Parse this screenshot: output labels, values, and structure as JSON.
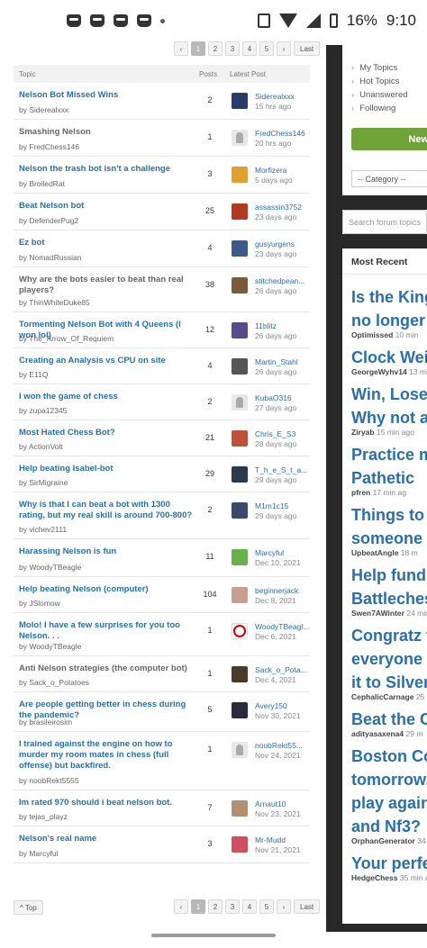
{
  "status": {
    "battery": "16%",
    "time": "9:10",
    "icons": [
      "discord-icon",
      "discord-icon",
      "discord-icon",
      "discord-icon",
      "dot-icon"
    ]
  },
  "pagination": {
    "pages": [
      "1",
      "2",
      "3",
      "4",
      "5"
    ],
    "last": "Last",
    "prev": "‹",
    "next": "›"
  },
  "table": {
    "col_topic": "Topic",
    "col_posts": "Posts",
    "col_latest": "Latest Post"
  },
  "topics": [
    {
      "title": "Nelson Bot Missed Wins",
      "author": "by Siderealxxx",
      "posts": "2",
      "user": "Siderealxxx",
      "time": "15 hrs ago",
      "read": false,
      "avatar": "#2a3b6b"
    },
    {
      "title": "Smashing Nelson",
      "author": "by FredChess146",
      "posts": "1",
      "user": "FredChess146",
      "time": "20 hrs ago",
      "read": true,
      "avatar": "#bdbdbd"
    },
    {
      "title": "Nelson the trash bot isn't a challenge",
      "author": "by BroiledRat",
      "posts": "3",
      "user": "Morfizera",
      "time": "5 days ago",
      "read": false,
      "avatar": "#e0a030"
    },
    {
      "title": "Beat Nelson bot",
      "author": "by DefenderPug2",
      "posts": "25",
      "user": "assassin3752",
      "time": "23 days ago",
      "read": false,
      "avatar": "#b33a1f"
    },
    {
      "title": "Ez bot",
      "author": "by NomadRussian",
      "posts": "4",
      "user": "gusyurgens",
      "time": "23 days ago",
      "read": false,
      "avatar": "#3a5a8a"
    },
    {
      "title": "Why are the bots easier to beat than real players?",
      "author": "by ThinWhiteDuke85",
      "posts": "38",
      "user": "stitchedpean...",
      "time": "26 days ago",
      "read": true,
      "avatar": "#7a5a3a"
    },
    {
      "title": "Tormenting Nelson Bot with 4 Queens (I won lol)",
      "author": "by The_Arrow_Of_Requiem",
      "posts": "12",
      "user": "11blitz",
      "time": "26 days ago",
      "read": false,
      "avatar": "#5a4a8a"
    },
    {
      "title": "Creating an Analysis vs CPU on site",
      "author": "by E11Q",
      "posts": "4",
      "user": "Martin_Stahl",
      "time": "26 days ago",
      "read": false,
      "avatar": "#555555"
    },
    {
      "title": "I won the game of chess",
      "author": "by zupa12345",
      "posts": "2",
      "user": "KubaO316",
      "time": "27 days ago",
      "read": false,
      "avatar": "#bdbdbd"
    },
    {
      "title": "Most Hated Chess Bot?",
      "author": "by ActionVolt",
      "posts": "21",
      "user": "Chris_E_S3",
      "time": "28 days ago",
      "read": false,
      "avatar": "#c0503a"
    },
    {
      "title": "Help beating Isabel-bot",
      "author": "by SirMigraine",
      "posts": "29",
      "user": "T_h_e_S_t_a...",
      "time": "29 days ago",
      "read": false,
      "avatar": "#2a3a4a"
    },
    {
      "title": "Why is that I can beat a bot with 1300 rating, but my real skill is around 700-800?",
      "author": "by vichev2111",
      "posts": "2",
      "user": "M1m1c15",
      "time": "29 days ago",
      "read": false,
      "avatar": "#3a4a6a"
    },
    {
      "title": "Harassing Nelson is fun",
      "author": "by WoodyTBeagle",
      "posts": "11",
      "user": "Marcyful",
      "time": "Dec 10, 2021",
      "read": false,
      "avatar": "#6ab04c"
    },
    {
      "title": "Help beating Nelson (computer)",
      "author": "by JSlomow",
      "posts": "104",
      "user": "beginnerjack",
      "time": "Dec 8, 2021",
      "read": false,
      "avatar": "#c8a090"
    },
    {
      "title": "Molo! I have a few surprises for you too Nelson. . .",
      "author": "by WoodyTBeagle",
      "posts": "1",
      "user": "WoodyTBeagl...",
      "time": "Dec 6, 2021",
      "read": false,
      "avatar": "#ffffff"
    },
    {
      "title": "Anti Nelson strategies (the computer bot)",
      "author": "by Sack_o_Potatoes",
      "posts": "1",
      "user": "Sack_o_Pota...",
      "time": "Dec 4, 2021",
      "read": true,
      "avatar": "#4a3a2a"
    },
    {
      "title": "Are people getting better in chess during the pandemic?",
      "author": "by brasileirosim",
      "posts": "5",
      "user": "Avery150",
      "time": "Nov 30, 2021",
      "read": false,
      "avatar": "#2a2a3a"
    },
    {
      "title": "I trained against the engine on how to murder my room mates in chess (full offense) but backfired.",
      "author": "by noobRekt5555",
      "posts": "1",
      "user": "noobRekt55...",
      "time": "Nov 24, 2021",
      "read": false,
      "avatar": "#bdbdbd"
    },
    {
      "title": "Im rated 970 should i beat nelson bot.",
      "author": "by tejas_playz",
      "posts": "7",
      "user": "Arnaut10",
      "time": "Nov 23, 2021",
      "read": false,
      "avatar": "#b09070"
    },
    {
      "title": "Nelson's real name",
      "author": "by Marcyful",
      "posts": "3",
      "user": "Mr-Mudd",
      "time": "Nov 21, 2021",
      "read": false,
      "avatar": "#d05060"
    }
  ],
  "top_button": "^ Top",
  "sidebar": {
    "links": [
      "My Topics",
      "Hot Topics",
      "Unanswered",
      "Following"
    ],
    "new_button": "New",
    "category": "-- Category --",
    "search_placeholder": "Search forum topics"
  },
  "most_recent": {
    "heading": "Most Recent",
    "items": [
      {
        "lines": [
          "Is the King",
          "no longer t"
        ],
        "user": "Optimissed",
        "time": "10 min"
      },
      {
        "lines": [
          "Clock Weir"
        ],
        "user": "GeorgeWyhv14",
        "time": "13 mi"
      },
      {
        "lines": [
          "Win, Lose",
          "Why not a"
        ],
        "user": "Ziryab",
        "time": "15 min ago"
      },
      {
        "lines": [
          "Practice m",
          "Pathetic"
        ],
        "user": "pfren",
        "time": "17 min ag"
      },
      {
        "lines": [
          "Things to l",
          "someone c"
        ],
        "user": "UpbeatAngle",
        "time": "18 m"
      },
      {
        "lines": [
          "Help fund",
          "Battleches"
        ],
        "user": "Swen7AWinter",
        "time": "24 min"
      },
      {
        "lines": [
          "Congratz t",
          "everyone w",
          "it to Silver"
        ],
        "user": "CephalicCarnage",
        "time": "25 m"
      },
      {
        "lines": [
          "Beat the C"
        ],
        "user": "adityasaxena4",
        "time": "29 m"
      },
      {
        "lines": [
          "Boston Co",
          "tomorrow,",
          "play again",
          "and Nf3?"
        ],
        "user": "OrphanGenerator",
        "time": "34 m"
      },
      {
        "lines": [
          "Your perfe"
        ],
        "user": "HedgeChess",
        "time": "35 min a"
      }
    ]
  }
}
